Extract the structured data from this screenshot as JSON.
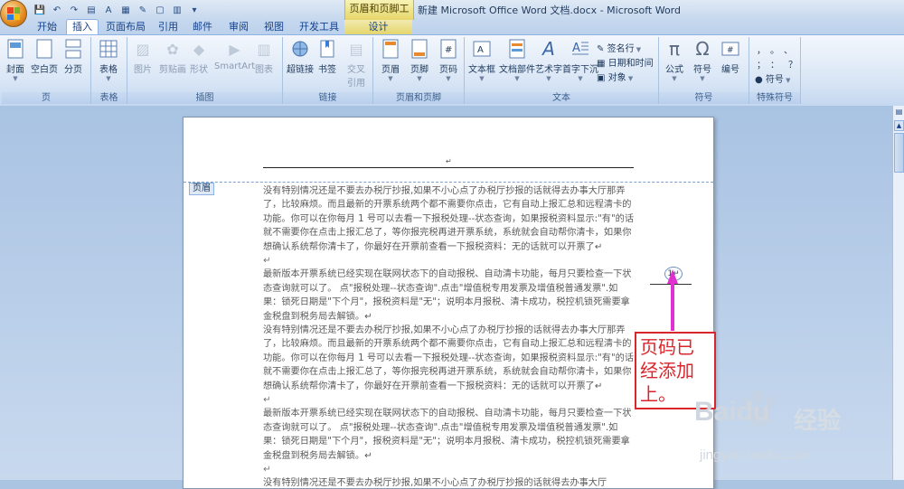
{
  "window": {
    "title": "新建 Microsoft Office Word 文档.docx - Microsoft Word",
    "context_tab_title": "页眉和页脚工具"
  },
  "tabs": [
    "开始",
    "插入",
    "页面布局",
    "引用",
    "邮件",
    "审阅",
    "视图",
    "开发工具",
    "设计"
  ],
  "active_tab": "插入",
  "ribbon": {
    "groups": {
      "page": "页",
      "table": "表格",
      "illustrations": "插图",
      "links": "链接",
      "header_footer": "页眉和页脚",
      "text": "文本",
      "symbols": "符号",
      "special": "特殊符号"
    },
    "buttons": {
      "cover": "封面",
      "blank_page": "空白页",
      "page_break": "分页",
      "table": "表格",
      "picture": "图片",
      "clipart": "剪贴画",
      "shapes": "形状",
      "smartart": "SmartArt",
      "chart": "图表",
      "hyperlink": "超链接",
      "bookmark": "书签",
      "crossref_1": "交叉",
      "crossref_2": "引用",
      "header": "页眉",
      "footer": "页脚",
      "page_number": "页码",
      "textbox": "文本框",
      "quickparts": "文档部件",
      "wordart": "艺术字",
      "dropcap": "首字下沉",
      "signature": "签名行",
      "datetime": "日期和时间",
      "object": "对象",
      "equation": "公式",
      "symbol": "符号",
      "numbering": "编号",
      "special_symbol": "符号"
    }
  },
  "document": {
    "header_tag": "页眉",
    "page_number_value": "1",
    "paragraph_mark": "↵",
    "paragraphs": [
      "没有特别情况还是不要去办税厅抄报,如果不小心点了办税厅抄报的话就得去办事大厅那弄了，比较麻烦。而且最新的开票系统两个都不需要你点击，它有自动上报汇总和远程清卡的功能。你可以在你每月 1 号可以去看一下报税处理--状态查询，如果报税资料显示:\"有\"的话就不需要你在点击上报汇总了，等你报完税再进开票系统，系统就会自动帮你清卡，如果你想确认系统帮你清卡了，你最好在开票前查看一下报税资料：无的话就可以开票了↵",
      "↵",
      "最新版本开票系统已经实现在联网状态下的自动报税、自动清卡功能，每月只要检查一下状态查询就可以了。 点\"报税处理--状态查询\".点击\"增值税专用发票及增值税普通发票\".如果：锁死日期是\"下个月\"，报税资料是\"无\"；说明本月报税、清卡成功，税控机锁死需要拿金税盘到税务局去解锁。↵",
      "没有特别情况还是不要去办税厅抄报,如果不小心点了办税厅抄报的话就得去办事大厅那弄了，比较麻烦。而且最新的开票系统两个都不需要你点击，它有自动上报汇总和远程清卡的功能。你可以在你每月 1 号可以去看一下报税处理--状态查询，如果报税资料显示:\"有\"的话就不需要你在点击上报汇总了，等你报完税再进开票系统，系统就会自动帮你清卡，如果你想确认系统帮你清卡了，你最好在开票前查看一下报税资料：无的话就可以开票了↵",
      "↵",
      "最新版本开票系统已经实现在联网状态下的自动报税、自动清卡功能，每月只要检查一下状态查询就可以了。 点\"报税处理--状态查询\".点击\"增值税专用发票及增值税普通发票\".如果：锁死日期是\"下个月\"，报税资料是\"无\"；说明本月报税、清卡成功，税控机锁死需要拿金税盘到税务局去解锁。↵",
      "↵",
      "没有特别情况还是不要去办税厅抄报,如果不小心点了办税厅抄报的话就得去办事大厅"
    ]
  },
  "annotation": {
    "callout_text": "页码已经添加上。",
    "color": "#d9262c",
    "arrow_color": "#e12fd0"
  },
  "watermark": {
    "brand": "Bai",
    "brand2": "du",
    "product": "经验",
    "url": "jingyan.baidu.com"
  }
}
